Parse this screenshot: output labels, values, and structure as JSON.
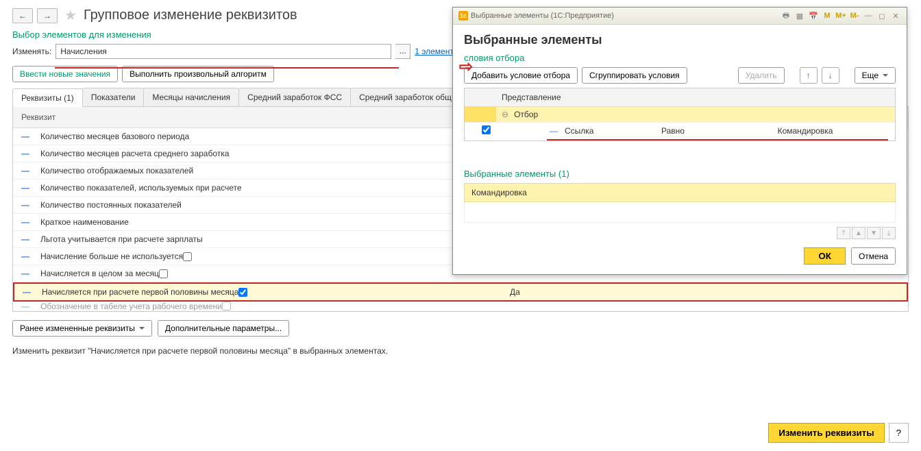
{
  "main": {
    "title": "Групповое изменение реквизитов",
    "section1_title": "Выбор элементов для изменения",
    "change_label": "Изменять:",
    "change_value": "Начисления",
    "elements_link": "1 элемент",
    "btn_new_values": "Ввести новые значения",
    "btn_algorithm": "Выполнить произвольный алгоритм",
    "tabs": [
      {
        "label": "Реквизиты (1)"
      },
      {
        "label": "Показатели"
      },
      {
        "label": "Месяцы начисления"
      },
      {
        "label": "Средний заработок ФСС"
      },
      {
        "label": "Средний заработок общ"
      }
    ],
    "grid_header": "Реквизит",
    "rows": [
      {
        "label": "Количество месяцев базового периода"
      },
      {
        "label": "Количество месяцев расчета среднего заработка"
      },
      {
        "label": "Количество отображаемых показателей"
      },
      {
        "label": "Количество показателей, используемых при расчете"
      },
      {
        "label": "Количество постоянных показателей"
      },
      {
        "label": "Краткое наименование"
      },
      {
        "label": "Льгота учитывается при расчете зарплаты"
      },
      {
        "label": "Начисление больше не используется"
      },
      {
        "label": "Начисляется в целом за месяц"
      },
      {
        "label": "Начисляется при расчете первой половины месяца",
        "checked": true,
        "value": "Да",
        "highlighted": true
      },
      {
        "label": "Обозначение в табеле учета рабочего времени"
      }
    ],
    "btn_prev_changed": "Ранее измененные реквизиты",
    "btn_extra_params": "Дополнительные параметры...",
    "summary": "Изменить реквизит \"Начисляется при расчете первой половины месяца\" в выбранных элементах.",
    "btn_apply": "Изменить реквизиты",
    "help": "?"
  },
  "dialog": {
    "titlebar": "Выбранные элементы  (1С:Предприятие)",
    "heading": "Выбранные элементы",
    "section_filter": "словия отбора",
    "btn_add_filter": "Добавить условие отбора",
    "btn_group_filter": "Сгруппировать условия",
    "btn_delete": "Удалить",
    "btn_more": "Еще",
    "filter_header": "Представление",
    "filter_root": "Отбор",
    "filter_field": "Ссылка",
    "filter_op": "Равно",
    "filter_val": "Командировка",
    "section_selected": "Выбранные элементы (1)",
    "selected_item": "Командировка",
    "btn_ok": "ОК",
    "btn_cancel": "Отмена",
    "m_buttons": [
      "M",
      "M+",
      "M-"
    ]
  }
}
